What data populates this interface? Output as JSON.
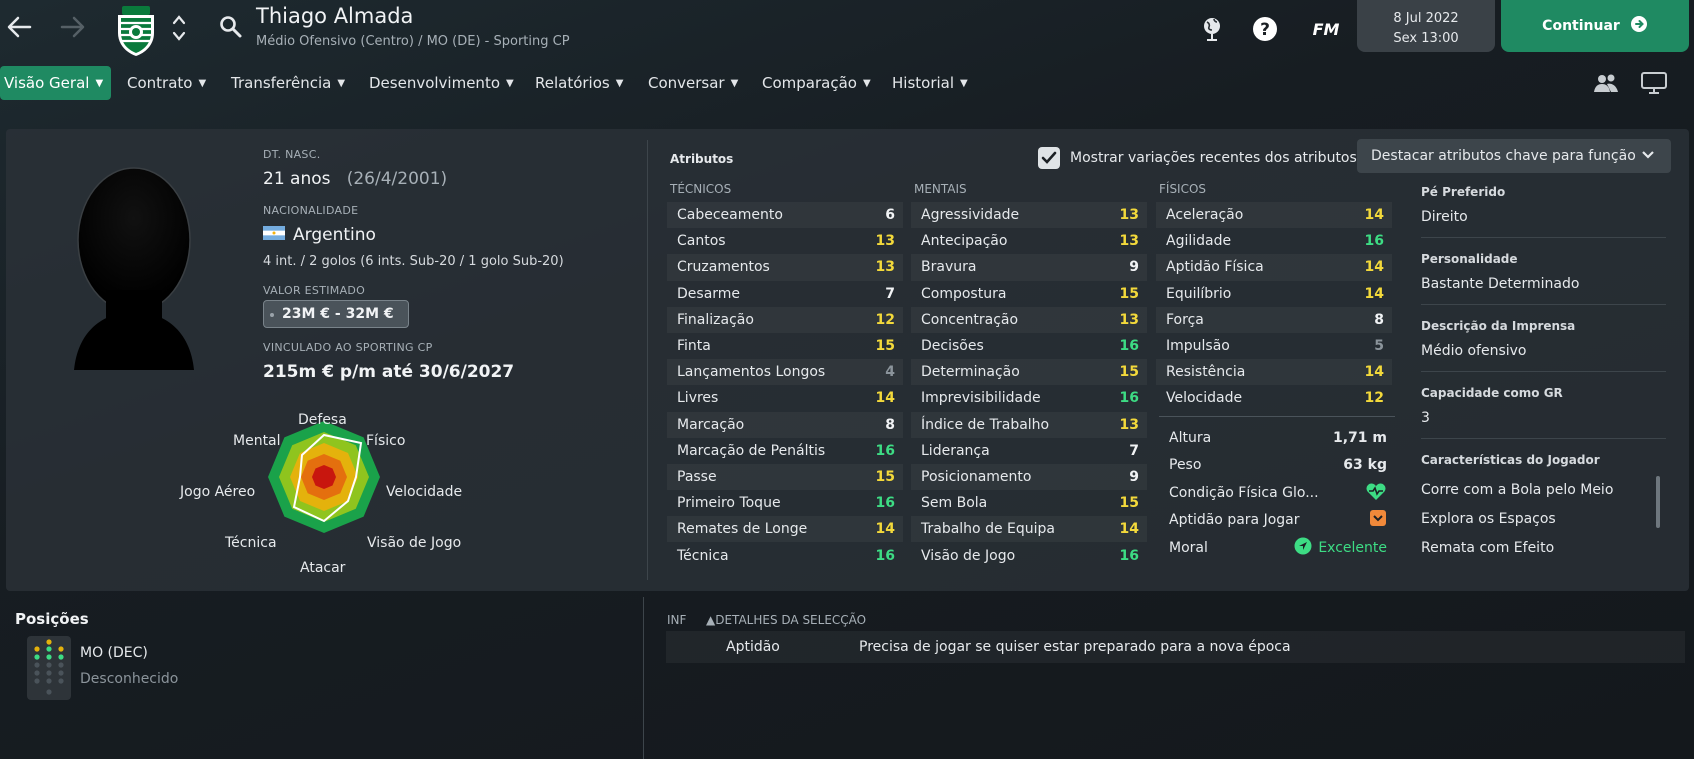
{
  "header": {
    "player_name": "Thiago Almada",
    "player_sub": "Médio Ofensivo (Centro) / MO (DE) - Sporting CP",
    "date": "8 Jul 2022",
    "time": "Sex 13:00",
    "fm_label": "FM",
    "continue_label": "Continuar"
  },
  "nav": {
    "tabs": [
      "Visão Geral",
      "Contrato",
      "Transferência",
      "Desenvolvimento",
      "Relatórios",
      "Conversar",
      "Comparação",
      "Historial"
    ]
  },
  "profile": {
    "dob_label": "DT. NASC.",
    "age": "21 anos",
    "dob": "(26/4/2001)",
    "nationality_label": "NACIONALIDADE",
    "nationality": "Argentino",
    "caps": "4 int. / 2 golos (6 ints. Sub-20 / 1 golo Sub-20)",
    "value_label": "VALOR ESTIMADO",
    "value": "23M € - 32M €",
    "contract_label": "VINCULADO AO SPORTING CP",
    "contract": "215m € p/m até 30/6/2027"
  },
  "radar": {
    "labels": [
      "Defesa",
      "Físico",
      "Velocidade",
      "Visão de Jogo",
      "Atacar",
      "Técnica",
      "Jogo Aéreo",
      "Mental"
    ]
  },
  "attributes": {
    "title": "Atributos",
    "show_changes_label": "Mostrar variações recentes dos atributos",
    "highlight_label": "Destacar atributos chave para função",
    "technical_header": "TÉCNICOS",
    "mental_header": "MENTAIS",
    "physical_header": "FÍSICOS",
    "technical": [
      {
        "name": "Cabeceamento",
        "value": "6"
      },
      {
        "name": "Cantos",
        "value": "13"
      },
      {
        "name": "Cruzamentos",
        "value": "13"
      },
      {
        "name": "Desarme",
        "value": "7"
      },
      {
        "name": "Finalização",
        "value": "12"
      },
      {
        "name": "Finta",
        "value": "15"
      },
      {
        "name": "Lançamentos Longos",
        "value": "4"
      },
      {
        "name": "Livres",
        "value": "14"
      },
      {
        "name": "Marcação",
        "value": "8"
      },
      {
        "name": "Marcação de Penáltis",
        "value": "16"
      },
      {
        "name": "Passe",
        "value": "15"
      },
      {
        "name": "Primeiro Toque",
        "value": "16"
      },
      {
        "name": "Remates de Longe",
        "value": "14"
      },
      {
        "name": "Técnica",
        "value": "16"
      }
    ],
    "mental": [
      {
        "name": "Agressividade",
        "value": "13"
      },
      {
        "name": "Antecipação",
        "value": "13"
      },
      {
        "name": "Bravura",
        "value": "9"
      },
      {
        "name": "Compostura",
        "value": "15"
      },
      {
        "name": "Concentração",
        "value": "13"
      },
      {
        "name": "Decisões",
        "value": "16"
      },
      {
        "name": "Determinação",
        "value": "15"
      },
      {
        "name": "Imprevisibilidade",
        "value": "16"
      },
      {
        "name": "Índice de Trabalho",
        "value": "13"
      },
      {
        "name": "Liderança",
        "value": "7"
      },
      {
        "name": "Posicionamento",
        "value": "9"
      },
      {
        "name": "Sem Bola",
        "value": "15"
      },
      {
        "name": "Trabalho de Equipa",
        "value": "14"
      },
      {
        "name": "Visão de Jogo",
        "value": "16"
      }
    ],
    "physical": [
      {
        "name": "Aceleração",
        "value": "14"
      },
      {
        "name": "Agilidade",
        "value": "16"
      },
      {
        "name": "Aptidão Física",
        "value": "14"
      },
      {
        "name": "Equilíbrio",
        "value": "14"
      },
      {
        "name": "Força",
        "value": "8"
      },
      {
        "name": "Impulsão",
        "value": "5"
      },
      {
        "name": "Resistência",
        "value": "14"
      },
      {
        "name": "Velocidade",
        "value": "12"
      }
    ],
    "extra": {
      "height_label": "Altura",
      "height": "1,71 m",
      "weight_label": "Peso",
      "weight": "63 kg",
      "condition_label": "Condição Física Glo...",
      "match_fit_label": "Aptidão para Jogar",
      "morale_label": "Moral",
      "morale": "Excelente"
    }
  },
  "info": {
    "foot_label": "Pé Preferido",
    "foot": "Direito",
    "personality_label": "Personalidade",
    "personality": "Bastante Determinado",
    "press_label": "Descrição da Imprensa",
    "press": "Médio ofensivo",
    "gk_label": "Capacidade como GR",
    "gk": "3",
    "traits_label": "Características do Jogador",
    "traits": [
      "Corre com a Bola pelo Meio",
      "Explora os Espaços",
      "Remata com Efeito"
    ]
  },
  "positions": {
    "title": "Posições",
    "position": "MO (DEC)",
    "status": "Desconhecido"
  },
  "details": {
    "inf_label": "INF",
    "header": "DETALHES DA SELECÇÃO",
    "row_key": "Aptidão",
    "row_value": "Precisa de jogar se quiser estar preparado para a nova época"
  },
  "colors": {
    "accent": "#1f8a62",
    "val_white": "#f1f3f5",
    "val_yellow": "#f3d93b",
    "val_green": "#3ddc84",
    "val_grey": "#8b949b"
  }
}
